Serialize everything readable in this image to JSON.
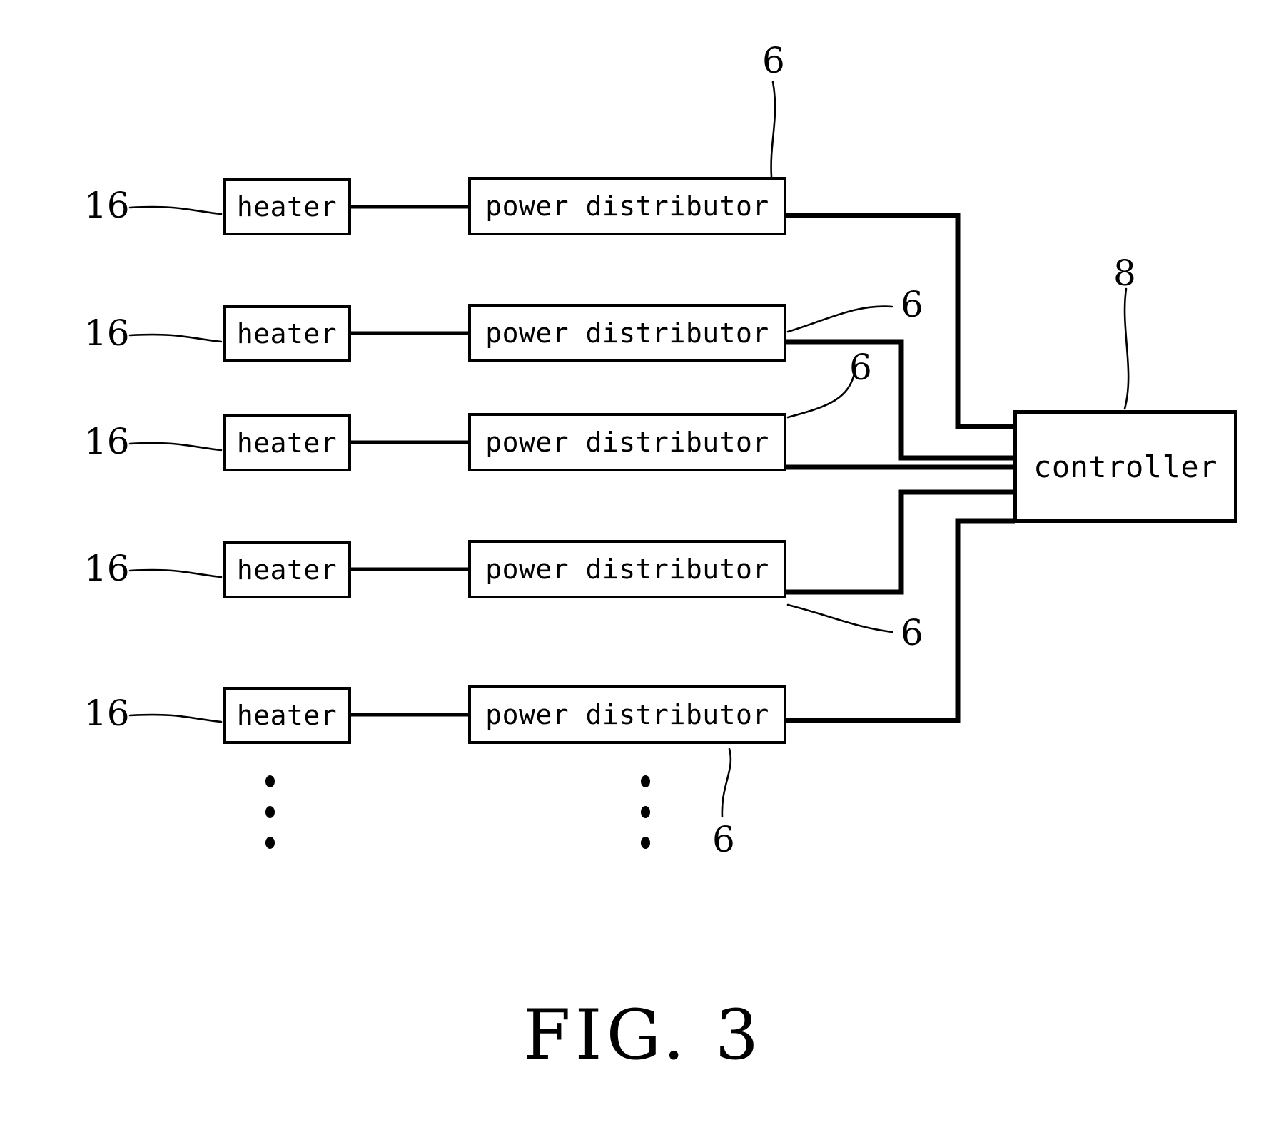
{
  "figure": {
    "caption": "FIG. 3",
    "title": "FIG. 3"
  },
  "blocks": {
    "heater_label": "heater",
    "power_distributor_label": "power distributor",
    "controller_label": "controller"
  },
  "rows": [
    {
      "index": 1,
      "heater": "heater",
      "power_distributor": "power distributor",
      "heater_ref": "16"
    },
    {
      "index": 2,
      "heater": "heater",
      "power_distributor": "power distributor",
      "heater_ref": "16"
    },
    {
      "index": 3,
      "heater": "heater",
      "power_distributor": "power distributor",
      "heater_ref": "16"
    },
    {
      "index": 4,
      "heater": "heater",
      "power_distributor": "power distributor",
      "heater_ref": "16"
    },
    {
      "index": 5,
      "heater": "heater",
      "power_distributor": "power distributor",
      "heater_ref": "16"
    }
  ],
  "reference_numerals": {
    "heater": "16",
    "power_distributor": "6",
    "controller": "8",
    "pd_top": "6",
    "pd_row2": "6",
    "pd_row3": "6",
    "pd_row4": "6",
    "pd_row5": "6"
  },
  "ellipsis": {
    "glyph": "•",
    "count": 3,
    "columns": [
      "heater-column",
      "power-distributor-column"
    ]
  },
  "colors": {
    "ink": "#000000",
    "paper": "#ffffff"
  }
}
